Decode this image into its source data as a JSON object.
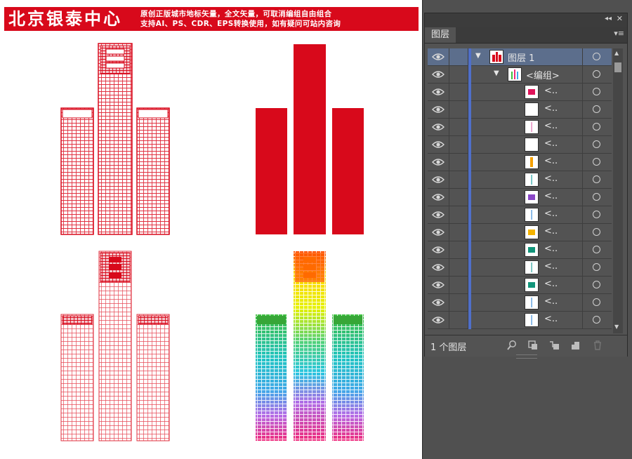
{
  "artboard": {
    "banner": {
      "title": "北京银泰中心",
      "line1": "原创正版城市地标矢量，全文矢量，可取消编组自由组合",
      "line2": "支持AI、PS、CDR、EPS转换使用，如有疑问可站内咨询",
      "color": "#d8091b"
    }
  },
  "layers_panel": {
    "tab": "图层",
    "layer_name": "图层 1",
    "group_name": "<编组>",
    "item_label": "<..",
    "items": [
      {
        "swatch": "#e0145a",
        "shape": "square"
      },
      {
        "swatch": "#ffffff",
        "shape": "none"
      },
      {
        "swatch": "#e06fb0",
        "shape": "line"
      },
      {
        "swatch": "#ffffff",
        "shape": "none"
      },
      {
        "swatch": "#f5a000",
        "shape": "bar"
      },
      {
        "swatch": "#22a3a3",
        "shape": "line"
      },
      {
        "swatch": "#8b47c7",
        "shape": "square"
      },
      {
        "swatch": "#3f8fd8",
        "shape": "line"
      },
      {
        "swatch": "#f5b400",
        "shape": "square"
      },
      {
        "swatch": "#11957a",
        "shape": "square"
      },
      {
        "swatch": "#2aa39c",
        "shape": "line"
      },
      {
        "swatch": "#11957a",
        "shape": "square"
      },
      {
        "swatch": "#3f8fd8",
        "shape": "line"
      },
      {
        "swatch": "#3f8fd8",
        "shape": "line"
      }
    ],
    "footer": {
      "layer_count": "1 个图层"
    },
    "accent": "#4f6fc9"
  }
}
